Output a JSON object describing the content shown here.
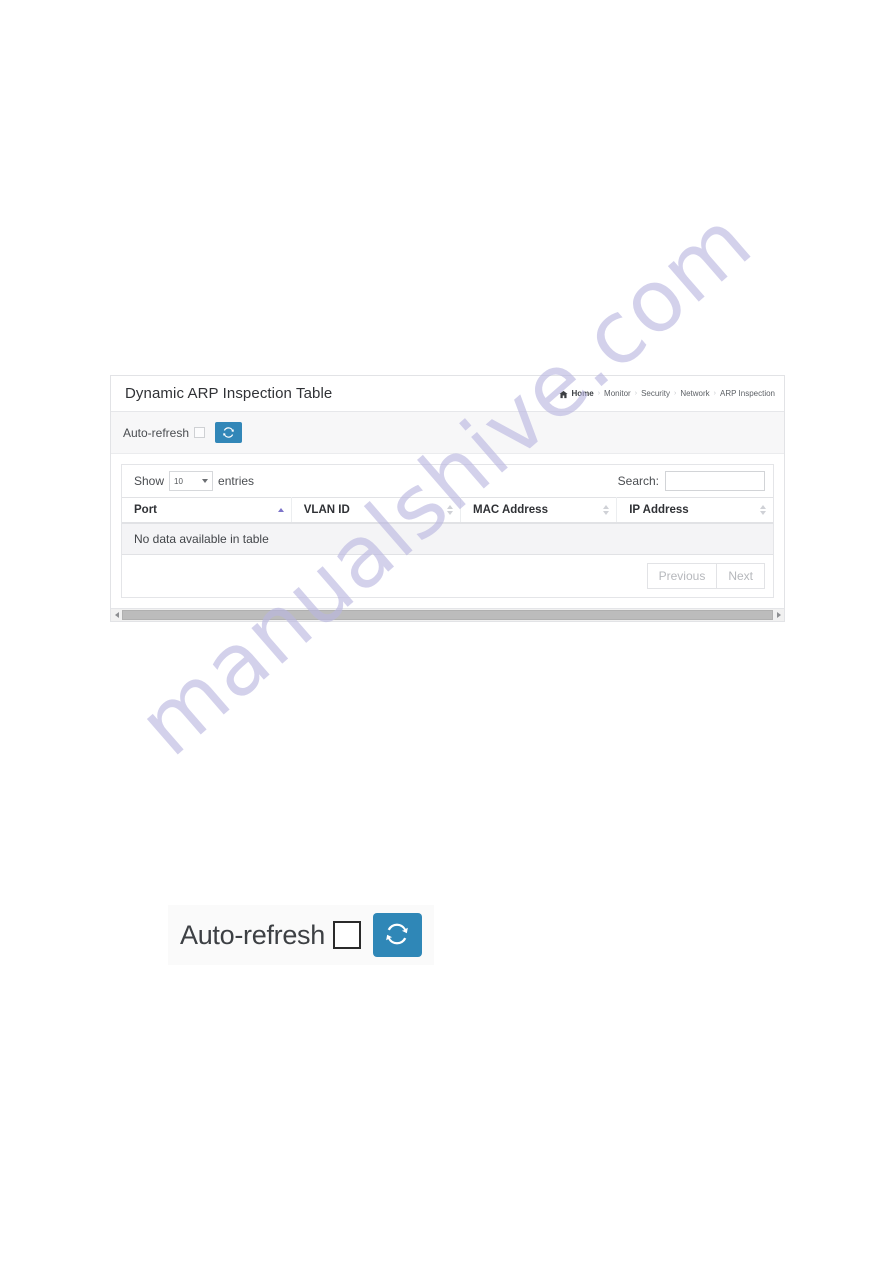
{
  "panel": {
    "title": "Dynamic ARP Inspection Table",
    "breadcrumb": {
      "home_icon": "home-icon",
      "items": [
        "Home",
        "Monitor",
        "Security",
        "Network",
        "ARP Inspection"
      ],
      "separator": "›"
    },
    "toolbar": {
      "auto_refresh_label": "Auto-refresh",
      "auto_refresh_checked": false,
      "refresh_icon": "refresh-icon"
    },
    "table": {
      "show_label": "Show",
      "entries_label": "entries",
      "page_length": "10",
      "search_label": "Search:",
      "search_value": "",
      "search_placeholder": "",
      "columns": [
        {
          "label": "Port",
          "sort": "asc"
        },
        {
          "label": "VLAN ID",
          "sort": "none"
        },
        {
          "label": "MAC Address",
          "sort": "none"
        },
        {
          "label": "IP Address",
          "sort": "none"
        }
      ],
      "rows": [],
      "empty_message": "No data available in table",
      "pagination": {
        "previous": "Previous",
        "next": "Next"
      }
    }
  },
  "detail": {
    "auto_refresh_label": "Auto-refresh",
    "refresh_icon": "refresh-icon"
  },
  "watermark": {
    "text": "manualshive.com"
  },
  "colors": {
    "accent_blue": "#3287b8",
    "accent_blue_large": "#2f87b7",
    "sort_active": "#7d74c9",
    "watermark": "#b9b6e0",
    "empty_row_bg": "#f4f4f6"
  }
}
